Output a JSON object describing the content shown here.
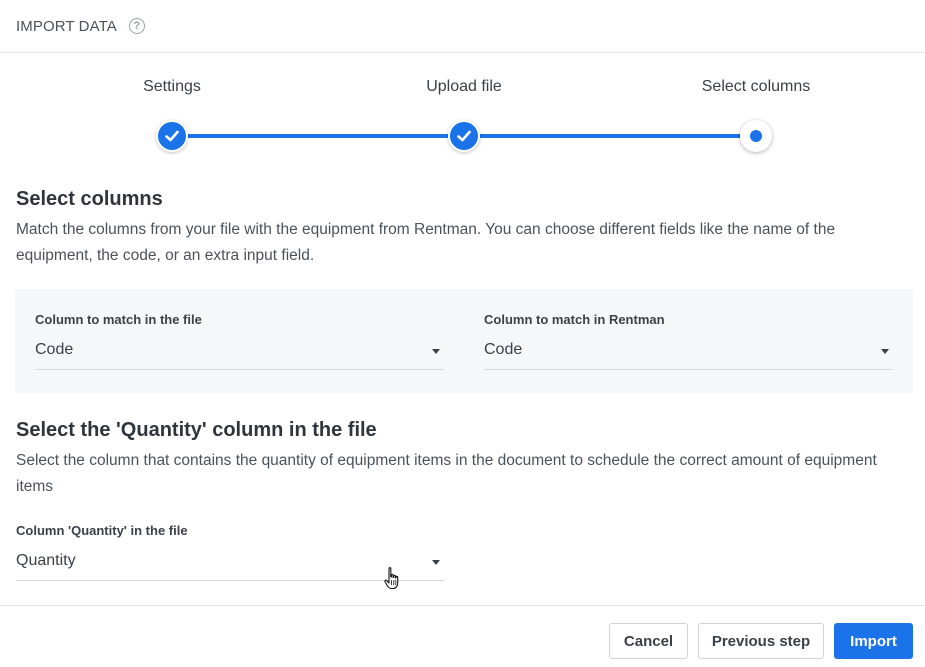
{
  "header": {
    "title": "IMPORT DATA",
    "help_icon": "help-circle-icon"
  },
  "stepper": {
    "steps": [
      {
        "label": "Settings",
        "state": "done"
      },
      {
        "label": "Upload file",
        "state": "done"
      },
      {
        "label": "Select columns",
        "state": "current"
      }
    ]
  },
  "select_columns": {
    "title": "Select columns",
    "description": "Match the columns from your file with the equipment from Rentman. You can choose different fields like the name of the equipment, the code, or an extra input field.",
    "file_field": {
      "label": "Column to match in the file",
      "value": "Code"
    },
    "rentman_field": {
      "label": "Column to match in Rentman",
      "value": "Code"
    }
  },
  "quantity": {
    "title": "Select the 'Quantity' column in the file",
    "description": "Select the column that contains the quantity of equipment items in the document to schedule the correct amount of equipment items",
    "field": {
      "label": "Column 'Quantity' in the file",
      "value": "Quantity"
    }
  },
  "footer": {
    "cancel_label": "Cancel",
    "previous_label": "Previous step",
    "import_label": "Import"
  },
  "colors": {
    "accent": "#1a73e8",
    "panel_bg": "#f6f7f9",
    "border": "#e3e5e8"
  }
}
